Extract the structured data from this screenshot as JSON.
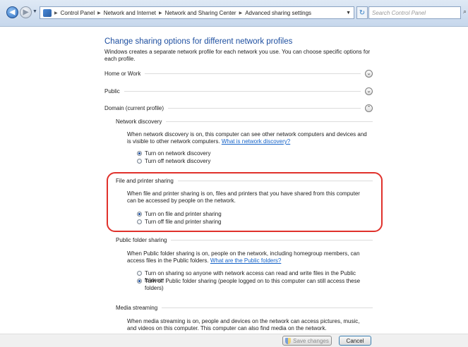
{
  "nav": {
    "back_icon": "back-arrow-icon",
    "forward_icon": "forward-arrow-icon",
    "breadcrumbs": [
      "Control Panel",
      "Network and Internet",
      "Network and Sharing Center",
      "Advanced sharing settings"
    ],
    "search_placeholder": "Search Control Panel"
  },
  "main": {
    "title": "Change sharing options for different network profiles",
    "intro": "Windows creates a separate network profile for each network you use. You can choose specific options for each profile.",
    "profiles": [
      {
        "label": "Home or Work",
        "expanded": false
      },
      {
        "label": "Public",
        "expanded": false
      },
      {
        "label": "Domain (current profile)",
        "expanded": true
      }
    ],
    "network_discovery": {
      "heading": "Network discovery",
      "desc": "When network discovery is on, this computer can see other network computers and devices and is visible to other network computers.",
      "link": "What is network discovery?",
      "options": [
        "Turn on network discovery",
        "Turn off network discovery"
      ],
      "selected": 0
    },
    "file_sharing": {
      "heading": "File and printer sharing",
      "desc": "When file and printer sharing is on, files and printers that you have shared from this computer can be accessed by people on the network.",
      "options": [
        "Turn on file and printer sharing",
        "Turn off file and printer sharing"
      ],
      "selected": 0
    },
    "public_folder": {
      "heading": "Public folder sharing",
      "desc": "When Public folder sharing is on, people on the network, including homegroup members, can access files in the Public folders.",
      "link": "What are the Public folders?",
      "options": [
        "Turn on sharing so anyone with network access can read and write files in the Public folders",
        "Turn off Public folder sharing (people logged on to this computer can still access these folders)"
      ],
      "selected": 1
    },
    "media_streaming": {
      "heading": "Media streaming",
      "desc": "When media streaming is on, people and devices on the network can access pictures, music, and videos on this computer. This computer can also find media on the network."
    }
  },
  "footer": {
    "save_label": "Save changes",
    "cancel_label": "Cancel"
  },
  "colors": {
    "title": "#1e4fa0",
    "link": "#1462c8",
    "highlight": "#e0312b"
  }
}
